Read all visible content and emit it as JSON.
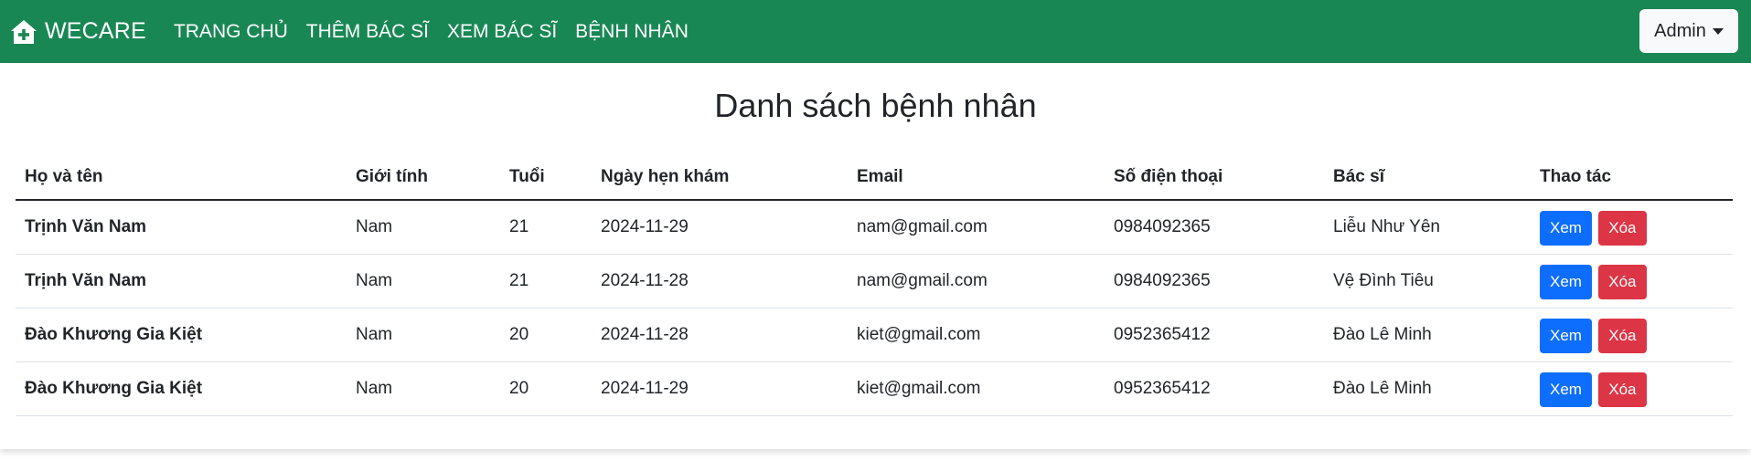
{
  "navbar": {
    "brand": "WECARE",
    "brand_icon": "house-medical-icon",
    "links": [
      "TRANG CHỦ",
      "THÊM BÁC SĨ",
      "XEM BÁC SĨ",
      "BỆNH NHÂN"
    ],
    "user_menu": "Admin",
    "background": "#198754"
  },
  "main": {
    "title": "Danh sách bệnh nhân",
    "table": {
      "headers": [
        "Họ và tên",
        "Giới tính",
        "Tuổi",
        "Ngày hẹn khám",
        "Email",
        "Số điện thoại",
        "Bác sĩ",
        "Thao tác"
      ],
      "rows": [
        {
          "name": "Trịnh Văn Nam",
          "gender": "Nam",
          "age": "21",
          "date": "2024-11-29",
          "email": "nam@gmail.com",
          "phone": "0984092365",
          "doctor": "Liễu Như Yên"
        },
        {
          "name": "Trịnh Văn Nam",
          "gender": "Nam",
          "age": "21",
          "date": "2024-11-28",
          "email": "nam@gmail.com",
          "phone": "0984092365",
          "doctor": "Vệ Đình Tiêu"
        },
        {
          "name": "Đào Khương Gia Kiệt",
          "gender": "Nam",
          "age": "20",
          "date": "2024-11-28",
          "email": "kiet@gmail.com",
          "phone": "0952365412",
          "doctor": "Đào Lê Minh"
        },
        {
          "name": "Đào Khương Gia Kiệt",
          "gender": "Nam",
          "age": "20",
          "date": "2024-11-29",
          "email": "kiet@gmail.com",
          "phone": "0952365412",
          "doctor": "Đào Lê Minh"
        }
      ],
      "actions": {
        "view": "Xem",
        "delete": "Xóa"
      }
    }
  },
  "colors": {
    "view_button": "#0d6efd",
    "delete_button": "#dc3545"
  }
}
